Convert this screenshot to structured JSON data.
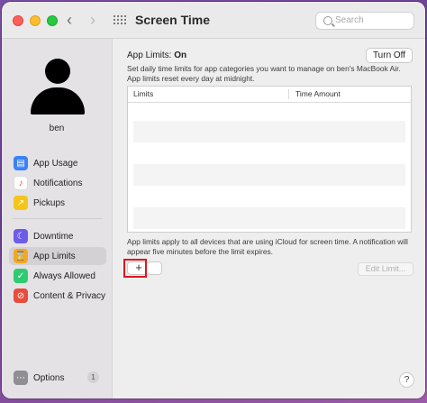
{
  "window": {
    "title": "Screen Time",
    "search_placeholder": "Search"
  },
  "icons": {
    "back": "‹",
    "forward": "›"
  },
  "sidebar": {
    "username": "ben",
    "items": [
      {
        "label": "App Usage",
        "icon": "layers-icon",
        "color": "#3b82f6",
        "glyph": "▤"
      },
      {
        "label": "Notifications",
        "icon": "bell-icon",
        "color": "#ffffff",
        "glyph": "🔔"
      },
      {
        "label": "Pickups",
        "icon": "pickups-icon",
        "color": "#f5c518",
        "glyph": "↗"
      },
      {
        "label": "Downtime",
        "icon": "moon-icon",
        "color": "#6c5ce7",
        "glyph": "☾"
      },
      {
        "label": "App Limits",
        "icon": "hourglass-icon",
        "color": "#f5a623",
        "glyph": "⌛"
      },
      {
        "label": "Always Allowed",
        "icon": "checkmark-icon",
        "color": "#2ecc71",
        "glyph": "✓"
      },
      {
        "label": "Content & Privacy",
        "icon": "restricted-icon",
        "color": "#e74c3c",
        "glyph": "⊘"
      }
    ],
    "options_label": "Options",
    "options_badge": "1"
  },
  "main": {
    "status_label": "App Limits:",
    "status_value": "On",
    "turn_off_label": "Turn Off",
    "description": "Set daily time limits for app categories you want to manage on ben's MacBook Air. App limits reset every day at midnight.",
    "table": {
      "col_limits": "Limits",
      "col_time": "Time Amount"
    },
    "footer_note": "App limits apply to all devices that are using iCloud for screen time. A notification will appear five minutes before the limit expires.",
    "add_label": "+",
    "edit_limit_label": "Edit Limit...",
    "help_label": "?"
  }
}
